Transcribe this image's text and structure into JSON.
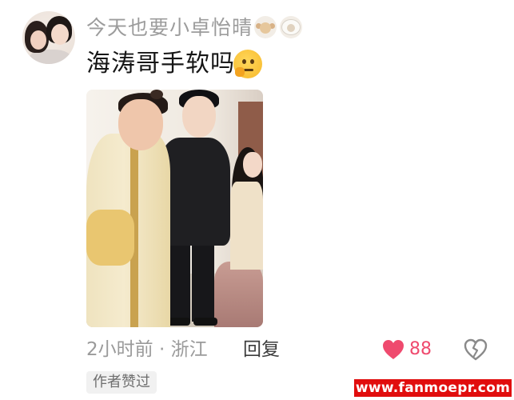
{
  "comment": {
    "username": "今天也要小卓怡晴",
    "user_badges": [
      "monkey-icon",
      "sheep-icon"
    ],
    "text": "海涛哥手软吗",
    "text_emoji": "thinking-face-icon",
    "photo": "comment-photo",
    "time_location": "2小时前 · 浙江",
    "reply_label": "回复",
    "like_count": "88",
    "like_icon": "heart-icon",
    "dislike_icon": "broken-heart-icon",
    "author_liked_label": "作者赞过"
  },
  "watermark": {
    "text": "www.fanmoepr.com"
  },
  "colors": {
    "like": "#ef4a6e",
    "secondary_text": "#9a9a9a",
    "watermark_bg": "#e10d0d"
  }
}
